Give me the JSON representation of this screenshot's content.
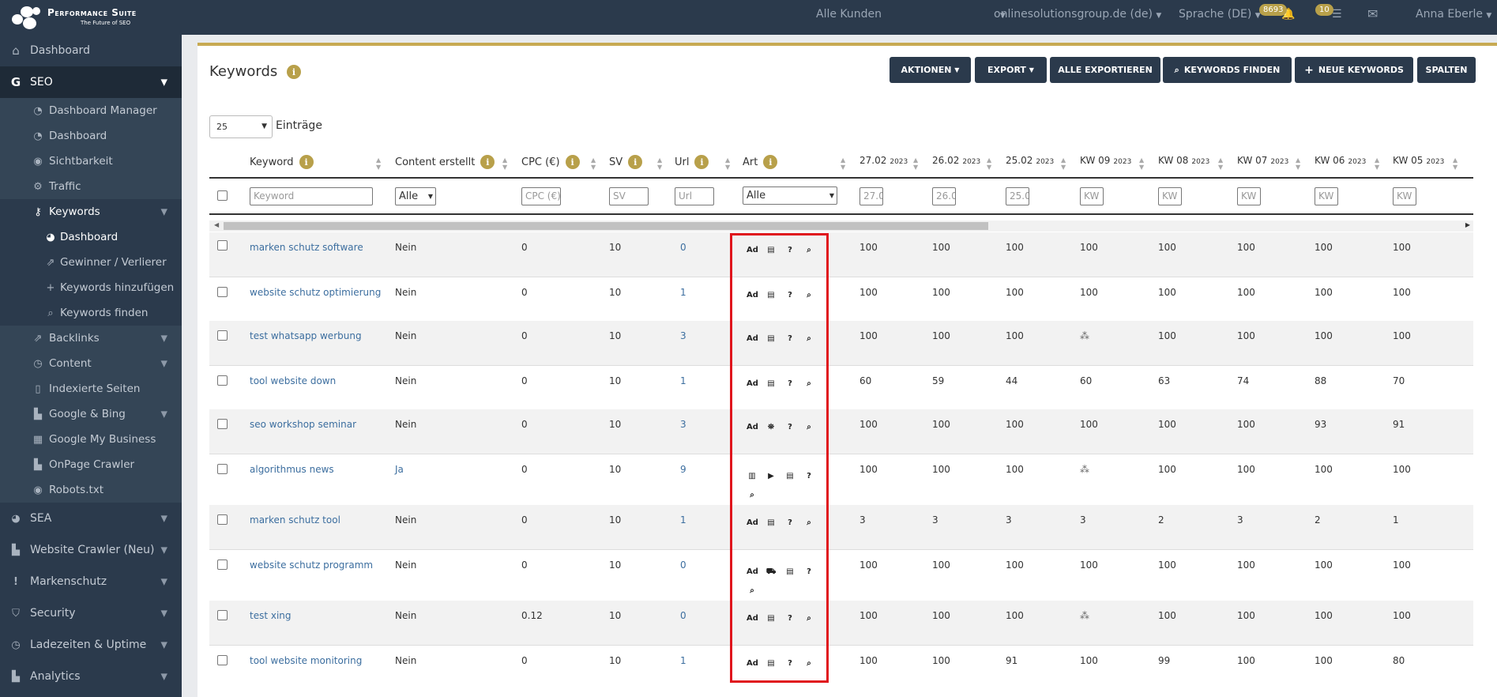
{
  "app": {
    "brand_title": "Performance Suite",
    "brand_subtitle": "The Future of SEO"
  },
  "topbar": {
    "customer_select": "Alle Kunden",
    "domain_select": "onlinesolutionsgroup.de (de)",
    "language": "Sprache (DE)",
    "notifications_count": "8693",
    "tasks_count": "10",
    "user_name": "Anna Eberle"
  },
  "sidebar": {
    "dashboard": "Dashboard",
    "seo": "SEO",
    "seo_items": [
      "Dashboard Manager",
      "Dashboard",
      "Sichtbarkeit",
      "Traffic"
    ],
    "keywords": "Keywords",
    "keywords_items": [
      "Dashboard",
      "Gewinner / Verlierer",
      "Keywords hinzufügen",
      "Keywords finden"
    ],
    "seo_items_2": [
      "Backlinks",
      "Content",
      "Indexierte Seiten",
      "Google & Bing",
      "Google My Business",
      "OnPage Crawler",
      "Robots.txt"
    ],
    "main_items": [
      "SEA",
      "Website Crawler (Neu)",
      "Markenschutz",
      "Security",
      "Ladezeiten & Uptime",
      "Analytics"
    ]
  },
  "page": {
    "title": "Keywords",
    "buttons": {
      "aktionen": "AKTIONEN",
      "export": "EXPORT",
      "alle_exportieren": "ALLE EXPORTIEREN",
      "keywords_finden": "KEYWORDS FINDEN",
      "neue_keywords": "NEUE KEYWORDS",
      "spalten": "SPALTEN"
    },
    "per_page": "25",
    "entries_label": "Einträge"
  },
  "table": {
    "headers": {
      "keyword": "Keyword",
      "content": "Content erstellt",
      "cpc": "CPC (€)",
      "sv": "SV",
      "url": "Url",
      "art": "Art",
      "d1": "27.02",
      "d2": "26.02",
      "d3": "25.02",
      "kw1": "KW 09",
      "kw2": "KW 08",
      "kw3": "KW 07",
      "kw4": "KW 06",
      "kw5": "KW 05",
      "year": "2023"
    },
    "filters": {
      "keyword": "Keyword",
      "content": "Alle",
      "cpc": "CPC (€)",
      "sv": "SV",
      "url": "Url",
      "art": "Alle",
      "d1": "27.0",
      "d2": "26.0",
      "d3": "25.0",
      "kw": "KW"
    },
    "rows": [
      {
        "keyword": "marken schutz software",
        "content": "Nein",
        "cpc": "0",
        "sv": "10",
        "url": "0",
        "vals": [
          "100",
          "100",
          "100",
          "100",
          "100",
          "100",
          "100",
          "100"
        ]
      },
      {
        "keyword": "website schutz optimierung",
        "content": "Nein",
        "cpc": "0",
        "sv": "10",
        "url": "1",
        "vals": [
          "100",
          "100",
          "100",
          "100",
          "100",
          "100",
          "100",
          "100"
        ]
      },
      {
        "keyword": "test whatsapp werbung",
        "content": "Nein",
        "cpc": "0",
        "sv": "10",
        "url": "3",
        "vals": [
          "100",
          "100",
          "100",
          "",
          "100",
          "100",
          "100",
          "100"
        ]
      },
      {
        "keyword": "tool website down",
        "content": "Nein",
        "cpc": "0",
        "sv": "10",
        "url": "1",
        "vals": [
          "60",
          "59",
          "44",
          "60",
          "63",
          "74",
          "88",
          "70"
        ]
      },
      {
        "keyword": "seo workshop seminar",
        "content": "Nein",
        "cpc": "0",
        "sv": "10",
        "url": "3",
        "vals": [
          "100",
          "100",
          "100",
          "100",
          "100",
          "100",
          "93",
          "91"
        ]
      },
      {
        "keyword": "algorithmus news",
        "content": "Ja",
        "cpc": "0",
        "sv": "10",
        "url": "9",
        "vals": [
          "100",
          "100",
          "100",
          "",
          "100",
          "100",
          "100",
          "100"
        ]
      },
      {
        "keyword": "marken schutz tool",
        "content": "Nein",
        "cpc": "0",
        "sv": "10",
        "url": "1",
        "vals": [
          "3",
          "3",
          "3",
          "3",
          "2",
          "3",
          "2",
          "1"
        ]
      },
      {
        "keyword": "website schutz programm",
        "content": "Nein",
        "cpc": "0",
        "sv": "10",
        "url": "0",
        "vals": [
          "100",
          "100",
          "100",
          "100",
          "100",
          "100",
          "100",
          "100"
        ]
      },
      {
        "keyword": "test xing",
        "content": "Nein",
        "cpc": "0.12",
        "sv": "10",
        "url": "0",
        "vals": [
          "100",
          "100",
          "100",
          "",
          "100",
          "100",
          "100",
          "100"
        ]
      },
      {
        "keyword": "tool website monitoring",
        "content": "Nein",
        "cpc": "0",
        "sv": "10",
        "url": "1",
        "vals": [
          "100",
          "100",
          "91",
          "100",
          "99",
          "100",
          "100",
          "80"
        ]
      }
    ]
  },
  "colors": {
    "sidebar": "#2b3a4c",
    "accent": "#b8a04a",
    "link": "#3c6e9f",
    "highlight": "#e0151d"
  }
}
